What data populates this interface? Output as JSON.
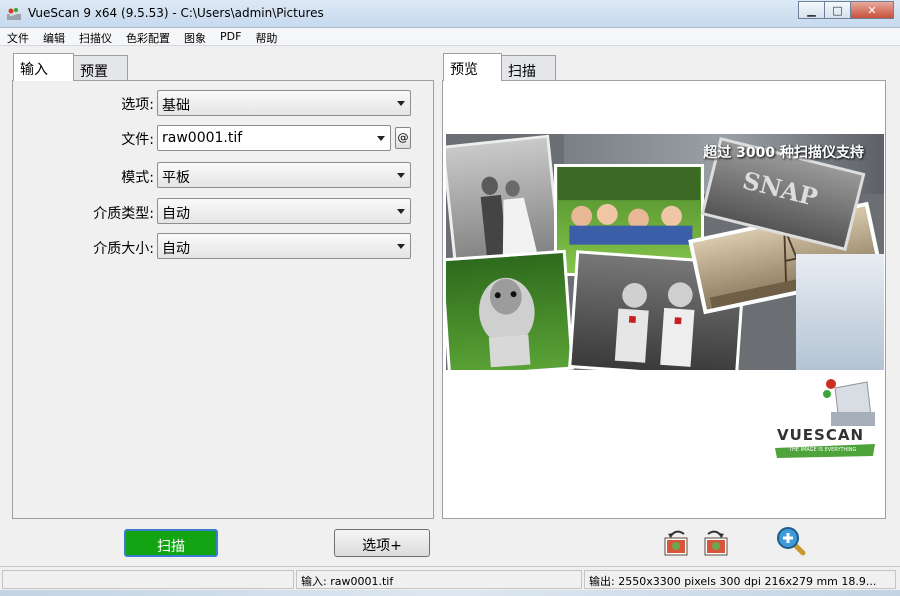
{
  "window": {
    "title": "VueScan 9 x64 (9.5.53) - C:\\Users\\admin\\Pictures"
  },
  "menu": [
    "文件",
    "编辑",
    "扫描仪",
    "色彩配置",
    "图象",
    "PDF",
    "帮助"
  ],
  "left_tabs": [
    "输入",
    "预置"
  ],
  "right_tabs": [
    "预览",
    "扫描"
  ],
  "fields": [
    {
      "label": "选项:",
      "value": "基础"
    },
    {
      "label": "文件:",
      "value": "raw0001.tif"
    },
    {
      "label": "模式:",
      "value": "平板"
    },
    {
      "label": "介质类型:",
      "value": "自动"
    },
    {
      "label": "介质大小:",
      "value": "自动"
    }
  ],
  "at_button": "@",
  "preview": {
    "caption": "超过 3000 种扫描仪支持",
    "logo_text": "VUESCAN",
    "logo_tagline": "THE IMAGE IS EVERYTHING",
    "photo_text": "SNAP"
  },
  "buttons": {
    "scan": "扫描",
    "more_options": "选项+"
  },
  "status": {
    "input": "输入: raw0001.tif",
    "output": "输出: 2550x3300 pixels 300 dpi 216x279 mm 18.9..."
  },
  "colors": {
    "scan_button": "#13a414",
    "accent": "#3b7cd0"
  }
}
